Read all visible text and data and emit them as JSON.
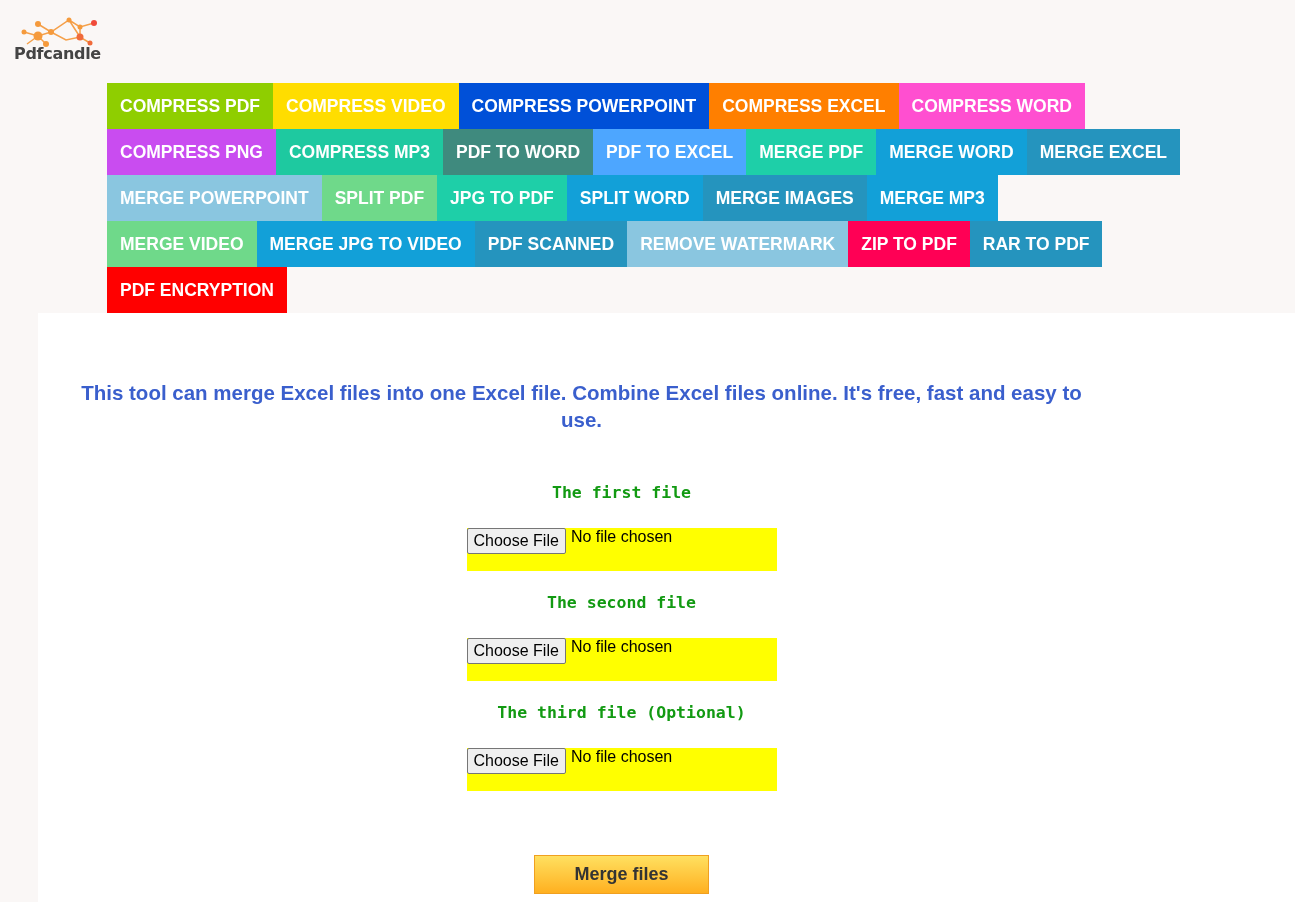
{
  "logo": {
    "text": "Pdfcandle"
  },
  "menu_rows": [
    [
      {
        "label": "COMPRESS PDF",
        "color": "#8fce00"
      },
      {
        "label": "COMPRESS VIDEO",
        "color": "#ffdd00"
      },
      {
        "label": "COMPRESS POWERPOINT",
        "color": "#0050d8"
      },
      {
        "label": "COMPRESS EXCEL",
        "color": "#ff7f00"
      },
      {
        "label": "COMPRESS WORD",
        "color": "#ff4fd0"
      }
    ],
    [
      {
        "label": "COMPRESS PNG",
        "color": "#c94cf0"
      },
      {
        "label": "COMPRESS MP3",
        "color": "#1ec9a0"
      },
      {
        "label": "PDF TO WORD",
        "color": "#3f8a7e"
      },
      {
        "label": "PDF TO EXCEL",
        "color": "#4da6ff"
      },
      {
        "label": "MERGE PDF",
        "color": "#1ecfa8"
      },
      {
        "label": "MERGE WORD",
        "color": "#12a0d8"
      },
      {
        "label": "MERGE EXCEL",
        "color": "#2594be"
      }
    ],
    [
      {
        "label": "MERGE POWERPOINT",
        "color": "#8ac6e0"
      },
      {
        "label": "SPLIT PDF",
        "color": "#6fd98a"
      },
      {
        "label": "JPG TO PDF",
        "color": "#1ecfa8"
      },
      {
        "label": "SPLIT WORD",
        "color": "#12a0d8"
      },
      {
        "label": "MERGE IMAGES",
        "color": "#2594be"
      },
      {
        "label": "MERGE MP3",
        "color": "#12a0d8"
      }
    ],
    [
      {
        "label": "MERGE VIDEO",
        "color": "#6fd98a"
      },
      {
        "label": "MERGE JPG TO VIDEO",
        "color": "#12a0d8"
      },
      {
        "label": "PDF SCANNED",
        "color": "#2594be"
      },
      {
        "label": "REMOVE WATERMARK",
        "color": "#8ac6e0"
      },
      {
        "label": "ZIP TO PDF",
        "color": "#ff0055"
      },
      {
        "label": "RAR TO PDF",
        "color": "#2594be"
      }
    ],
    [
      {
        "label": "PDF ENCRYPTION",
        "color": "#ff0000"
      }
    ]
  ],
  "description": "This tool can merge Excel files into one Excel file. Combine Excel files online. It's free, fast and easy to use.",
  "files": [
    {
      "label": "The first file",
      "button": "Choose File",
      "status": "No file chosen"
    },
    {
      "label": "The second file",
      "button": "Choose File",
      "status": "No file chosen"
    },
    {
      "label": "The third file (Optional)",
      "button": "Choose File",
      "status": "No file chosen"
    }
  ],
  "submit": "Merge files"
}
